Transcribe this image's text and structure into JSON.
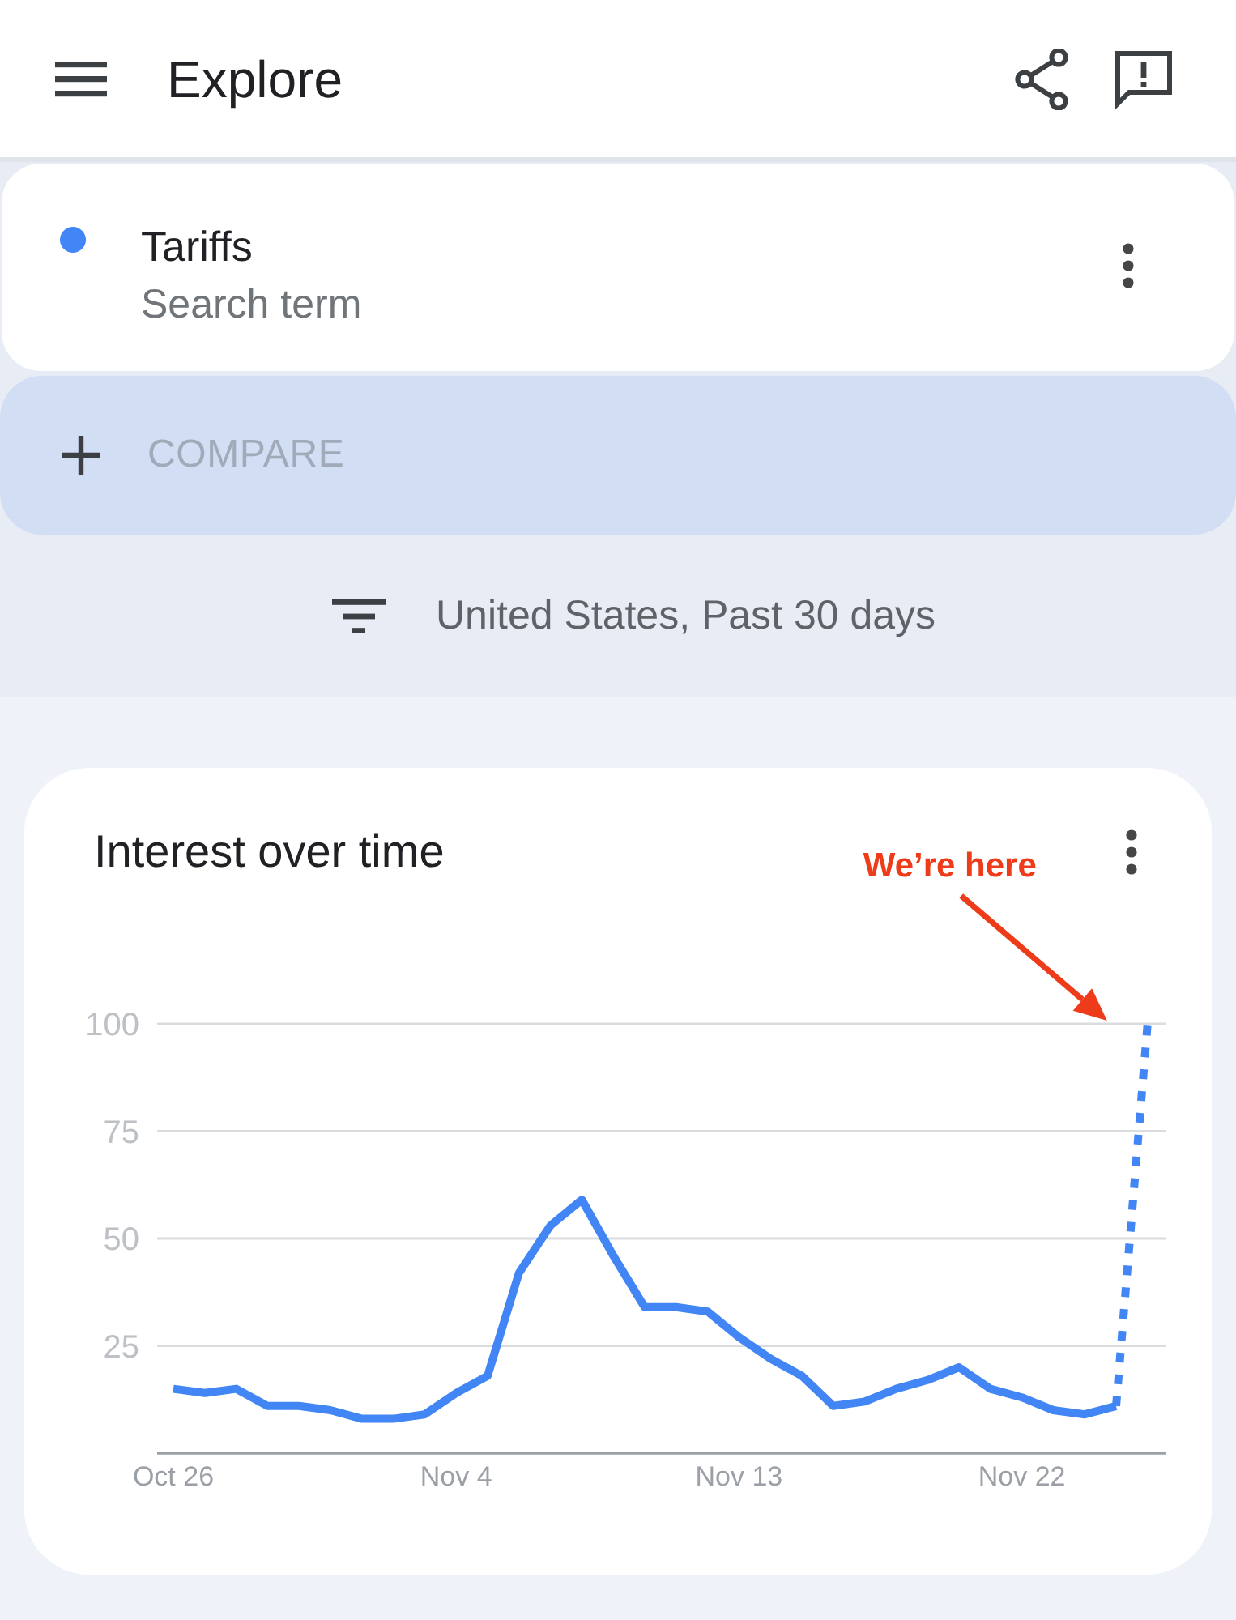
{
  "app_bar": {
    "title": "Explore"
  },
  "search_terms": [
    {
      "term": "Tariffs",
      "subtitle": "Search term",
      "color": "#4285f4"
    }
  ],
  "compare": {
    "label": "COMPARE"
  },
  "filter": {
    "label": "United States, Past 30 days"
  },
  "interest_over_time": {
    "title": "Interest over time",
    "chart_data": {
      "type": "line",
      "categories": [
        "Oct 26",
        null,
        null,
        null,
        null,
        null,
        null,
        null,
        null,
        "Nov 4",
        null,
        null,
        null,
        null,
        null,
        null,
        null,
        null,
        "Nov 13",
        null,
        null,
        null,
        null,
        null,
        null,
        null,
        null,
        "Nov 22",
        null,
        null,
        null,
        null
      ],
      "series": [
        {
          "color": "#4285f4",
          "values": [
            15,
            14,
            15,
            11,
            11,
            10,
            8,
            8,
            9,
            14,
            18,
            42,
            53,
            59,
            46,
            34,
            34,
            33,
            27,
            22,
            18,
            11,
            12,
            15,
            17,
            20,
            15,
            13,
            10,
            9,
            11,
            null
          ]
        },
        {
          "color": "#4285f4",
          "line_style": "dotted",
          "values": [
            null,
            null,
            null,
            null,
            null,
            null,
            null,
            null,
            null,
            null,
            null,
            null,
            null,
            null,
            null,
            null,
            null,
            null,
            null,
            null,
            null,
            null,
            null,
            null,
            null,
            null,
            null,
            null,
            null,
            null,
            11,
            100
          ]
        }
      ],
      "ylim": [
        0,
        100
      ],
      "yticks": [
        25,
        50,
        75,
        100
      ],
      "grid": true,
      "annotations": [
        "We’re here"
      ]
    }
  }
}
